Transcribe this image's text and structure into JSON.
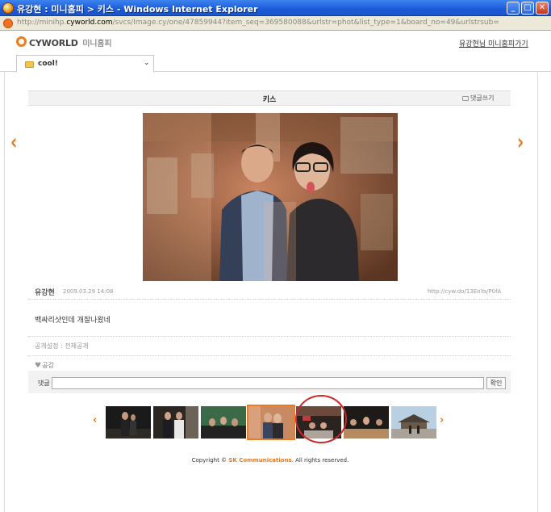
{
  "window": {
    "title": "유강현 : 미니홈피 > 키스 - Windows Internet Explorer",
    "minimize": "_",
    "maximize": "□",
    "close": "✕"
  },
  "address": {
    "prefix": "http://minihp.",
    "domain": "cyworld.com",
    "suffix": "/svcs/Image.cy/one/47859944?item_seq=369580088&urlstr=phot&list_type=1&board_no=49&urlstrsub="
  },
  "header": {
    "logo": "CYWORLD",
    "logo_sub": "미니홈피",
    "home_link": "유강현님 미니홈피가기"
  },
  "folder": {
    "name": "cool!",
    "chevron": "⌄"
  },
  "post": {
    "title": "키스",
    "comment_write": "댓글쓰기",
    "prev_arrow": "‹",
    "next_arrow": "›",
    "author": "유강현",
    "date": "2009.03.29 14:08",
    "short_url": "http://cyw.do/13EoYa/P0fA",
    "body": "백싸리샷인데 개잘나왔네",
    "visibility": "공개설정 : 전체공개",
    "like_icon": "♥",
    "like": "공감"
  },
  "comment": {
    "label": "댓글",
    "input_value": "",
    "confirm": "확인"
  },
  "thumbnails": {
    "prev": "‹",
    "next": "›",
    "selected_index": 3,
    "items": [
      "thumb-1",
      "thumb-2",
      "thumb-3",
      "thumb-4",
      "thumb-5",
      "thumb-6",
      "thumb-7"
    ]
  },
  "footer": {
    "prefix": "Copyright © ",
    "brand": "SK Communications",
    "suffix": ". All rights reserved."
  },
  "colors": {
    "accent": "#e8771e",
    "circle": "#c92a2a"
  }
}
